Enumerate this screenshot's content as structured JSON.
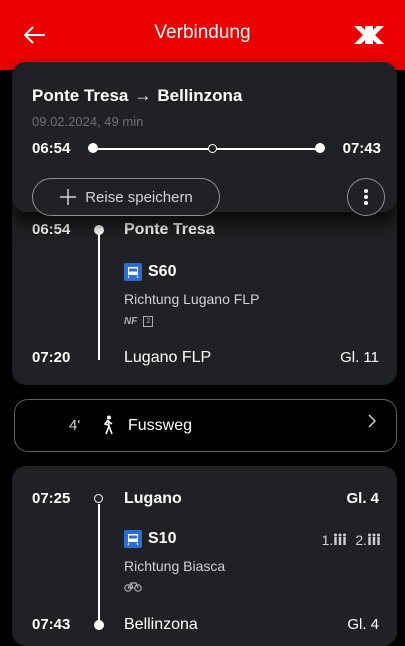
{
  "header": {
    "title": "Verbindung",
    "back_icon": "arrow-left-icon",
    "logo_icon": "sbb-logo-icon",
    "color": "#eb0000"
  },
  "summary": {
    "from": "Ponte Tresa",
    "arrow": "→",
    "to": "Bellinzona",
    "meta": "09.02.2024, 49 min",
    "departure": "06:54",
    "arrival": "07:43",
    "save_label": "Reise speichern",
    "more_icon": "more-vertical-icon"
  },
  "leg1": {
    "dep_time": "06:54",
    "dep_stop": "Ponte Tresa",
    "train_icon": "train-icon",
    "train": "S60",
    "direction": "Richtung Lugano FLP",
    "attr_nf": "NF",
    "attr_class": "2",
    "arr_time": "07:20",
    "arr_stop": "Lugano FLP",
    "arr_platform": "Gl. 11"
  },
  "walk": {
    "duration": "4'",
    "icon": "pedestrian-icon",
    "label": "Fussweg",
    "chevron": "›"
  },
  "leg2": {
    "dep_time": "07:25",
    "dep_stop": "Lugano",
    "dep_platform": "Gl. 4",
    "train_icon": "train-icon",
    "train": "S10",
    "occupancy_1": "1.",
    "occupancy_2": "2.",
    "direction": "Richtung Biasca",
    "bike_icon": "bicycle-icon",
    "arr_time": "07:43",
    "arr_stop": "Bellinzona",
    "arr_platform": "Gl. 4"
  }
}
